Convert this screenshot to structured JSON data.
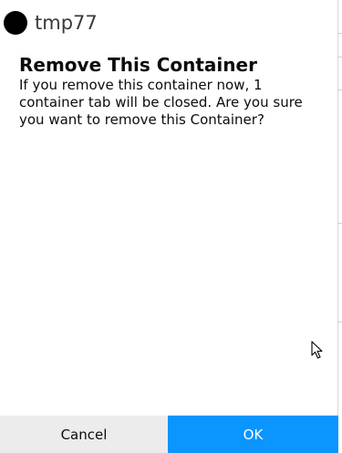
{
  "header": {
    "name": "tmp77",
    "icon": "circle-icon",
    "icon_color": "#000000"
  },
  "dialog": {
    "title": "Remove This Container",
    "message": "If you remove this container now, 1 container tab will be closed. Are you sure you want to remove this Container?"
  },
  "buttons": {
    "cancel_label": "Cancel",
    "ok_label": "OK"
  },
  "colors": {
    "primary": "#0a95ff",
    "secondary_bg": "#ececec",
    "text": "#0c0c0d"
  }
}
